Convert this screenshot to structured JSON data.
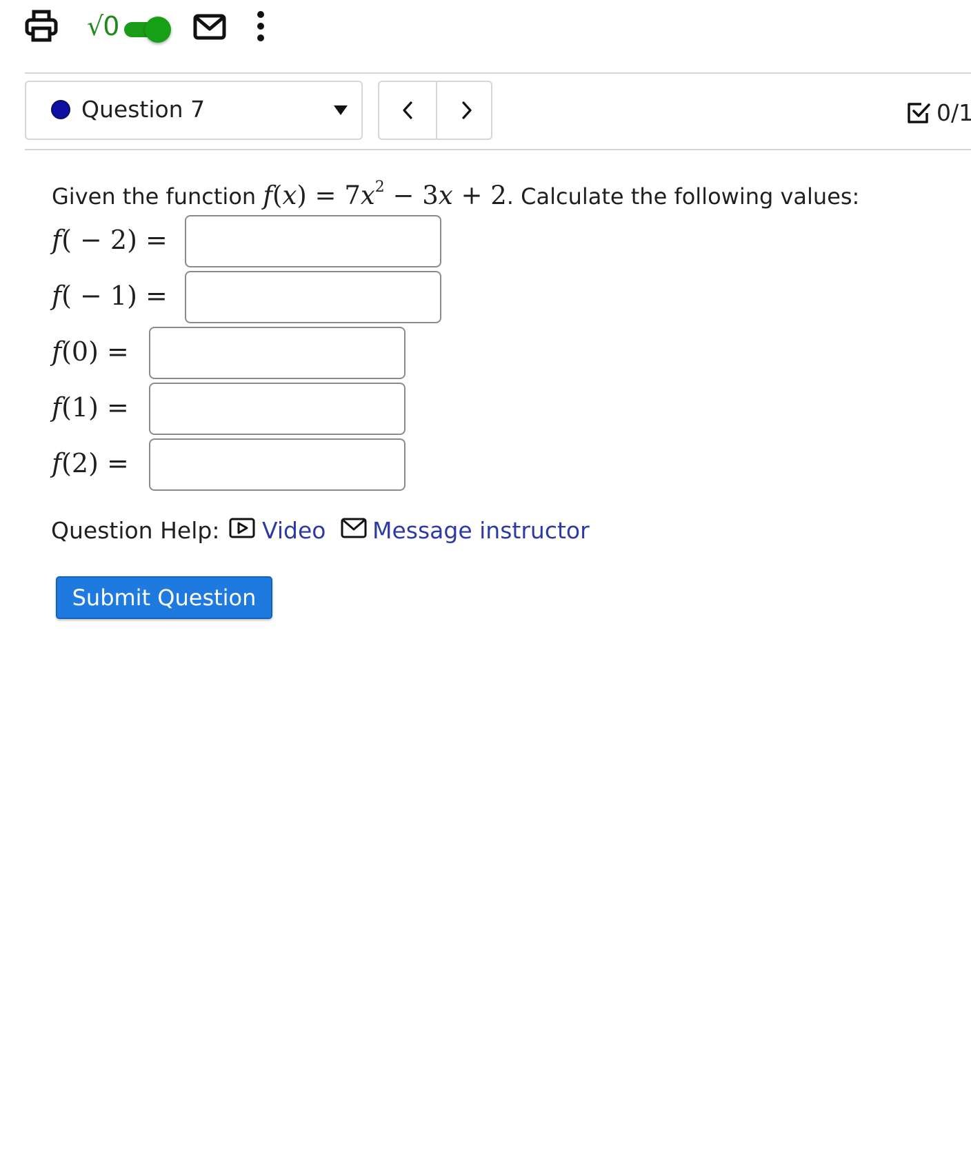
{
  "toolbar": {
    "sqrt_label": "√0",
    "math_toggle_on": true
  },
  "question_nav": {
    "label": "Question 7",
    "status_color": "#1010a0"
  },
  "score": {
    "text": "0/1"
  },
  "question": {
    "prompt_prefix": "Given the function",
    "formula": {
      "f": "f",
      "x": "x",
      "coef": "7",
      "exp": "2",
      "minus_term": "3",
      "const": "2"
    },
    "prompt_suffix": ". Calculate the following values:",
    "answers": [
      {
        "arg": "( − 2) =",
        "value": ""
      },
      {
        "arg": "( − 1) =",
        "value": ""
      },
      {
        "arg": "(0) =",
        "value": ""
      },
      {
        "arg": "(1) =",
        "value": ""
      },
      {
        "arg": "(2) =",
        "value": ""
      }
    ]
  },
  "help": {
    "label": "Question Help:",
    "video_label": "Video",
    "message_label": "Message instructor"
  },
  "submit_label": "Submit Question",
  "colors": {
    "accent_green": "#1a9c1a",
    "link_blue": "#2c3aa8",
    "button_blue": "#1f7ae0"
  }
}
